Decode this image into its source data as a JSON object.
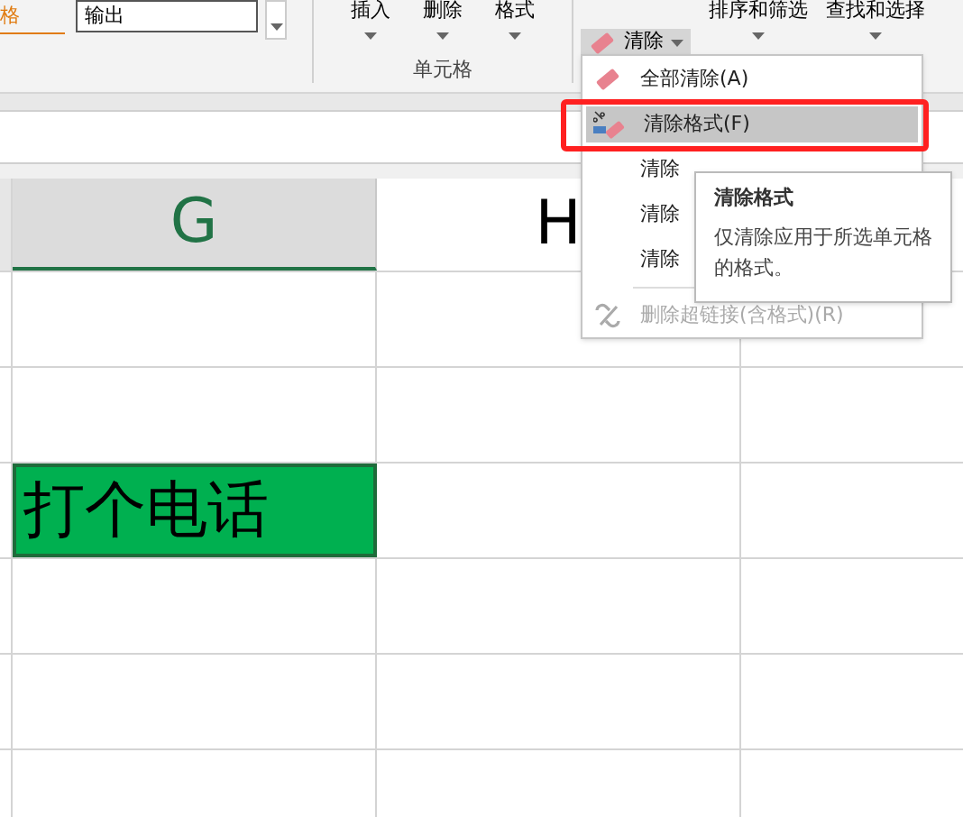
{
  "ribbon": {
    "style_label": "格",
    "cell_style": "输出",
    "cell_buttons": [
      "插入",
      "删除",
      "格式"
    ],
    "cells_group_label": "单元格",
    "clear_button": "清除",
    "sort_filter": "排序和筛选",
    "find_select": "查找和选择"
  },
  "columns": [
    {
      "label": "G",
      "selected": true
    },
    {
      "label": "H",
      "selected": false
    }
  ],
  "cell": {
    "text": "打个电话"
  },
  "menu": {
    "items": [
      {
        "kind": "eraser",
        "label": "全部清除(A)",
        "selected": false,
        "disabled": false
      },
      {
        "kind": "format",
        "label": "清除格式(F)",
        "selected": true,
        "disabled": false
      },
      {
        "kind": "blank",
        "label": "清除",
        "selected": false,
        "disabled": false
      },
      {
        "kind": "blank",
        "label": "清除",
        "selected": false,
        "disabled": false
      },
      {
        "kind": "blank",
        "label": "清除",
        "selected": false,
        "disabled": false
      },
      {
        "kind": "unlink",
        "label": "删除超链接(含格式)(R)",
        "selected": false,
        "disabled": true
      }
    ]
  },
  "tooltip": {
    "title": "清除格式",
    "body": "仅清除应用于所选单元格的格式。"
  }
}
